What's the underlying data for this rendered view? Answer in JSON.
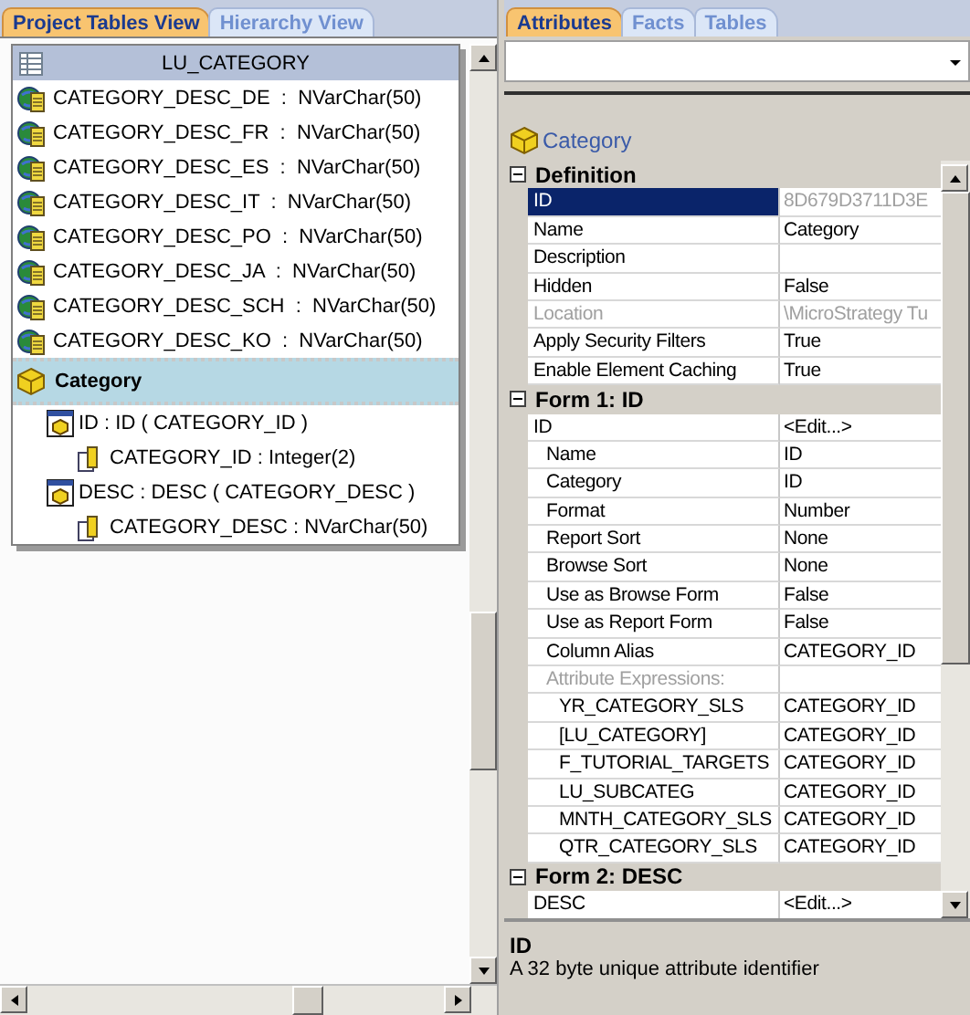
{
  "left_tabs": [
    {
      "label": "Project Tables View",
      "selected": true
    },
    {
      "label": "Hierarchy View",
      "selected": false
    }
  ],
  "table_card": {
    "title": "LU_CATEGORY",
    "columns": [
      {
        "label": "CATEGORY_DESC_DE  :  NVarChar(50)"
      },
      {
        "label": "CATEGORY_DESC_FR  :  NVarChar(50)"
      },
      {
        "label": "CATEGORY_DESC_ES  :  NVarChar(50)"
      },
      {
        "label": "CATEGORY_DESC_IT  :  NVarChar(50)"
      },
      {
        "label": "CATEGORY_DESC_PO  :  NVarChar(50)"
      },
      {
        "label": "CATEGORY_DESC_JA  :  NVarChar(50)"
      },
      {
        "label": "CATEGORY_DESC_SCH  :  NVarChar(50)"
      },
      {
        "label": "CATEGORY_DESC_KO  :  NVarChar(50)"
      }
    ],
    "attribute": {
      "name": "Category",
      "selected": true
    },
    "forms": [
      {
        "label": "ID : ID ( CATEGORY_ID )",
        "columns": [
          {
            "label": "CATEGORY_ID : Integer(2)"
          }
        ]
      },
      {
        "label": "DESC : DESC ( CATEGORY_DESC )",
        "columns": [
          {
            "label": "CATEGORY_DESC : NVarChar(50)"
          }
        ]
      }
    ]
  },
  "right_tabs": [
    {
      "label": "Attributes",
      "selected": true
    },
    {
      "label": "Facts",
      "selected": false
    },
    {
      "label": "Tables",
      "selected": false
    }
  ],
  "object": {
    "name": "Category"
  },
  "sections": [
    {
      "title": "Definition",
      "expanded": true,
      "rows": [
        {
          "name": "ID",
          "value": "8D679D3711D3E",
          "selected": true,
          "disabled": true
        },
        {
          "name": "Name",
          "value": "Category",
          "selected": false,
          "disabled": false
        },
        {
          "name": "Description",
          "selected": false,
          "disabled": false
        },
        {
          "name": "Hidden",
          "value": "False",
          "selected": false,
          "disabled": false
        },
        {
          "name": "Location",
          "value": "\\MicroStrategy Tu",
          "selected": false,
          "disabled": true
        },
        {
          "name": "Apply Security Filters",
          "value": "True",
          "selected": false,
          "disabled": false
        },
        {
          "name": "Enable Element Caching",
          "value": "True",
          "selected": false,
          "disabled": false
        }
      ]
    },
    {
      "title": "Form 1: ID",
      "expanded": true,
      "rows": [
        {
          "name": "ID",
          "value": "<Edit...>",
          "selected": false,
          "disabled": false,
          "children": [
            {
              "name": "Name",
              "value": "ID",
              "selected": false,
              "disabled": false
            },
            {
              "name": "Category",
              "value": "ID",
              "selected": false,
              "disabled": false
            },
            {
              "name": "Format",
              "value": "Number",
              "selected": false,
              "disabled": false
            },
            {
              "name": "Report Sort",
              "value": "None",
              "selected": false,
              "disabled": false
            },
            {
              "name": "Browse Sort",
              "value": "None",
              "selected": false,
              "disabled": false
            },
            {
              "name": "Use as Browse Form",
              "value": "False",
              "selected": false,
              "disabled": false
            },
            {
              "name": "Use as Report Form",
              "value": "False",
              "selected": false,
              "disabled": false
            },
            {
              "name": "Column Alias",
              "value": "CATEGORY_ID",
              "selected": false,
              "disabled": false
            },
            {
              "name": "Attribute Expressions:",
              "selected": false,
              "disabled": true,
              "children": [
                {
                  "name": "YR_CATEGORY_SLS",
                  "value": "CATEGORY_ID",
                  "selected": false,
                  "disabled": false
                },
                {
                  "name": "[LU_CATEGORY]",
                  "value": "CATEGORY_ID",
                  "selected": false,
                  "disabled": false
                },
                {
                  "name": "F_TUTORIAL_TARGETS",
                  "value": "CATEGORY_ID",
                  "selected": false,
                  "disabled": false
                },
                {
                  "name": "LU_SUBCATEG",
                  "value": "CATEGORY_ID",
                  "selected": false,
                  "disabled": false
                },
                {
                  "name": "MNTH_CATEGORY_SLS",
                  "value": "CATEGORY_ID",
                  "selected": false,
                  "disabled": false
                },
                {
                  "name": "QTR_CATEGORY_SLS",
                  "value": "CATEGORY_ID",
                  "selected": false,
                  "disabled": false
                }
              ]
            }
          ]
        }
      ]
    },
    {
      "title": "Form 2: DESC",
      "expanded": true,
      "rows": [
        {
          "name": "DESC",
          "value": "<Edit...>",
          "selected": false,
          "disabled": false
        }
      ]
    }
  ],
  "description": {
    "title": "ID",
    "text": "A 32 byte unique attribute identifier"
  }
}
